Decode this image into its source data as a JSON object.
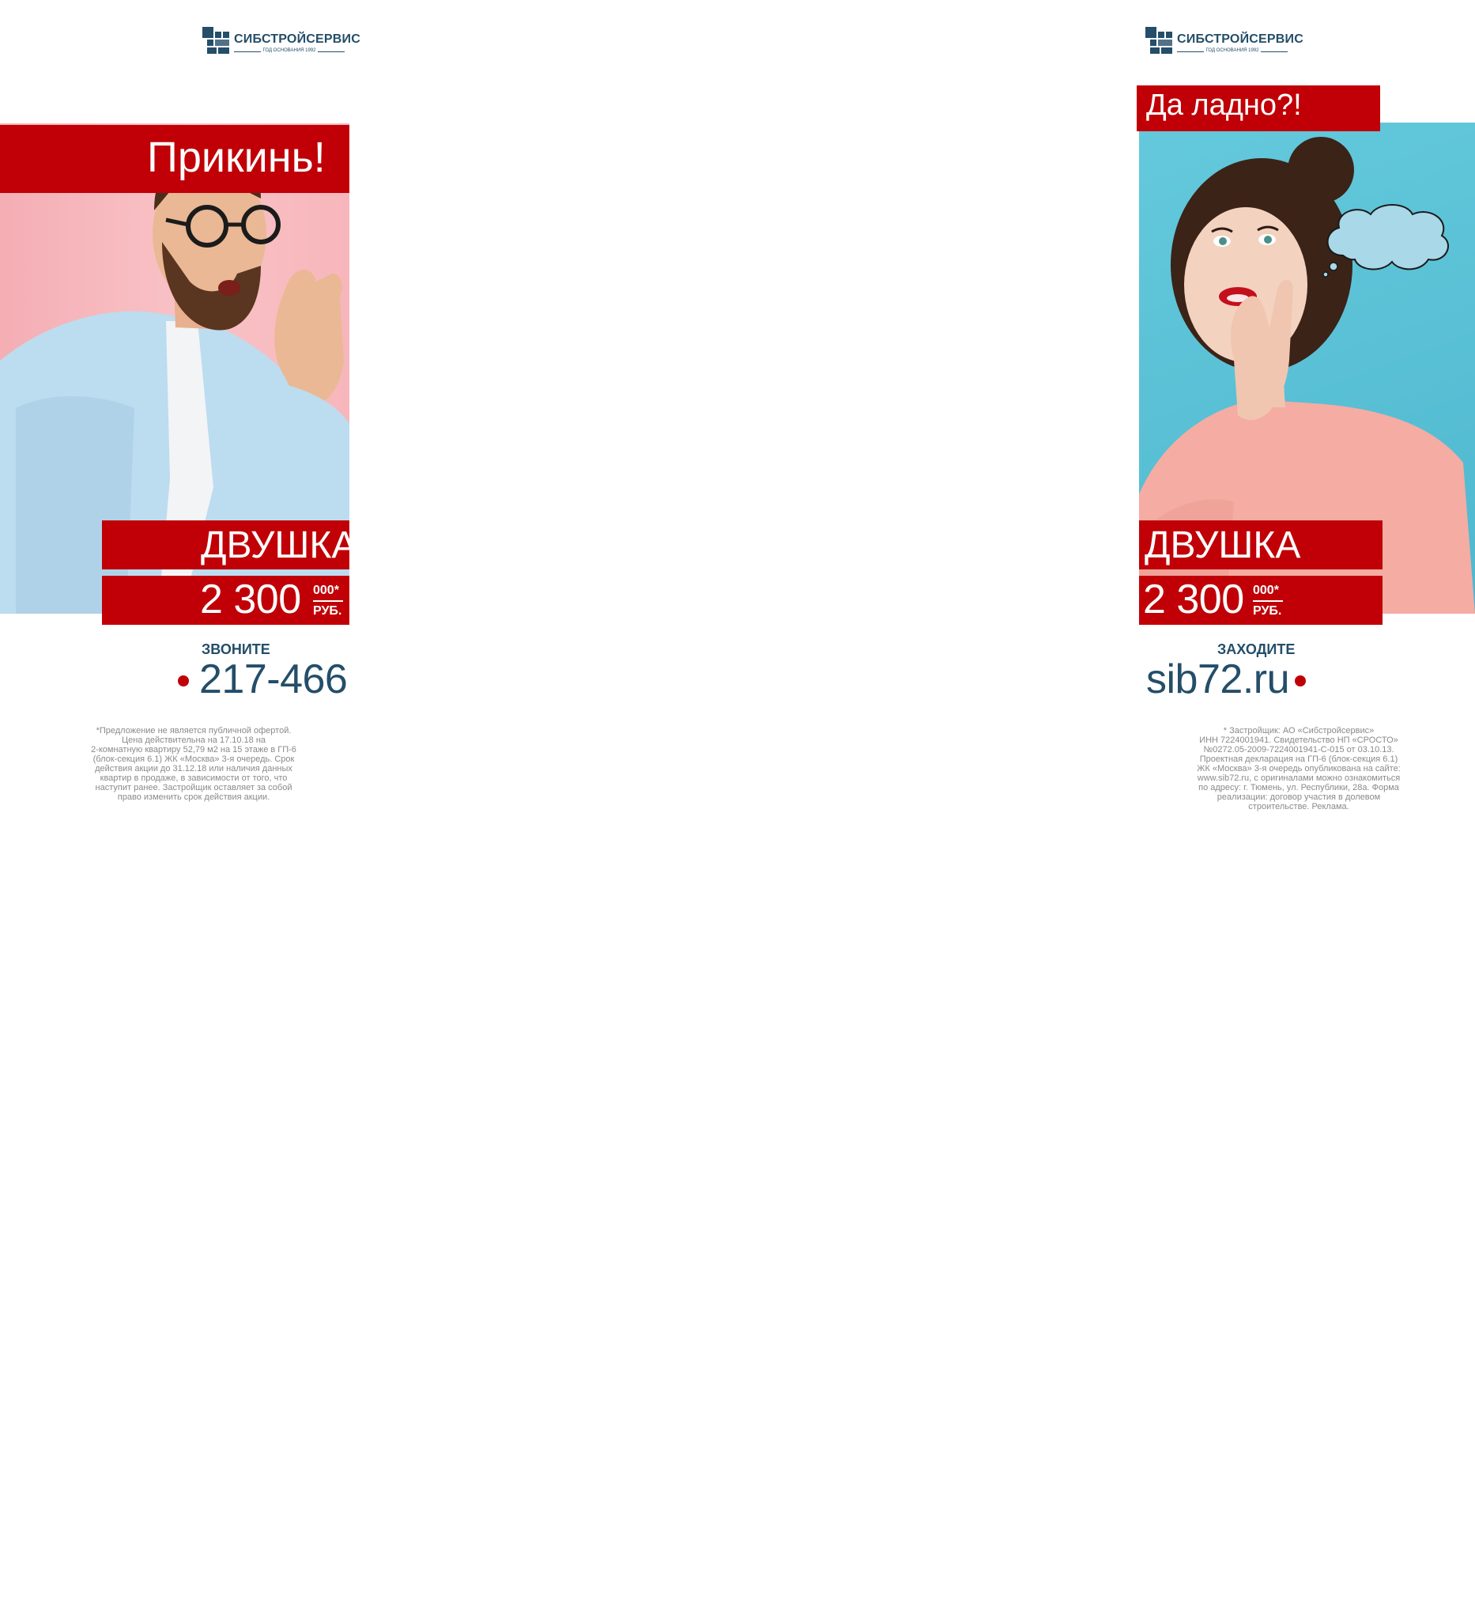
{
  "brand": {
    "name": "СИБСТРОЙСЕРВИС",
    "since": "ГОД ОСНОВАНИЯ 1992"
  },
  "banner_left": {
    "headline": "Прикинь!",
    "product": "ДВУШКА",
    "price": "2 300",
    "price_thousands": "000*",
    "currency": "РУБ.",
    "cta_label": "ЗВОНИТЕ",
    "cta_value": "217-466",
    "disclaimer": "*Предложение не является публичной офертой.\nЦена действительна на 17.10.18 на\n2-комнатную квартиру 52,79 м2 на 15 этаже в ГП-6\n(блок-секция 6.1) ЖК «Москва» 3-я очередь. Срок\nдействия акции до 31.12.18 или наличия данных\nквартир в продаже, в зависимости от того, что\nнаступит ранее. Застройщик оставляет за собой\nправо изменить срок действия акции."
  },
  "banner_right": {
    "headline": "Да ладно?!",
    "product": "ДВУШКА",
    "price": "2 300",
    "price_thousands": "000*",
    "currency": "РУБ.",
    "cta_label": "ЗАХОДИТЕ",
    "cta_value": "sib72.ru",
    "disclaimer": "* Застройщик: АО «Сибстройсервис»\nИНН 7224001941. Свидетельство НП «СРОСТО»\n№0272.05-2009-7224001941-С-015 от 03.10.13.\nПроектная декларация на ГП-6 (блок-секция 6.1)\nЖК «Москва» 3-я очередь опубликована на сайте:\nwww.sib72.ru, с оригиналами можно ознакомиться\nпо адресу: г. Тюмень, ул. Республики, 28а.  Форма\nреализации: договор участия в долевом\nстроительстве. Реклама."
  },
  "colors": {
    "accent_red": "#c00006",
    "brand_blue": "#244e69",
    "left_bg": "#f7b9be",
    "right_bg": "#5cc2d6"
  }
}
